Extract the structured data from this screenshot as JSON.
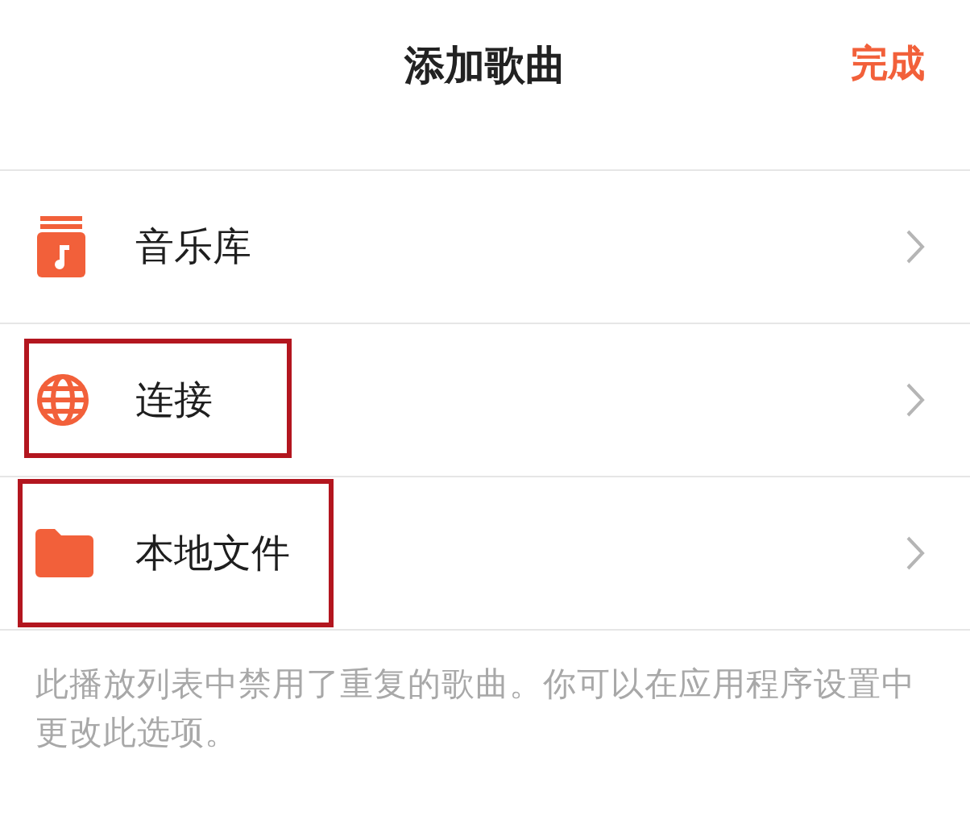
{
  "header": {
    "title": "添加歌曲",
    "done": "完成"
  },
  "items": [
    {
      "kind": "library",
      "label": "音乐库",
      "highlighted": false
    },
    {
      "kind": "globe",
      "label": "连接",
      "highlighted": true
    },
    {
      "kind": "folder",
      "label": "本地文件",
      "highlighted": true
    }
  ],
  "footnote": "此播放列表中禁用了重复的歌曲。你可以在应用程序设置中更改此选项。"
}
